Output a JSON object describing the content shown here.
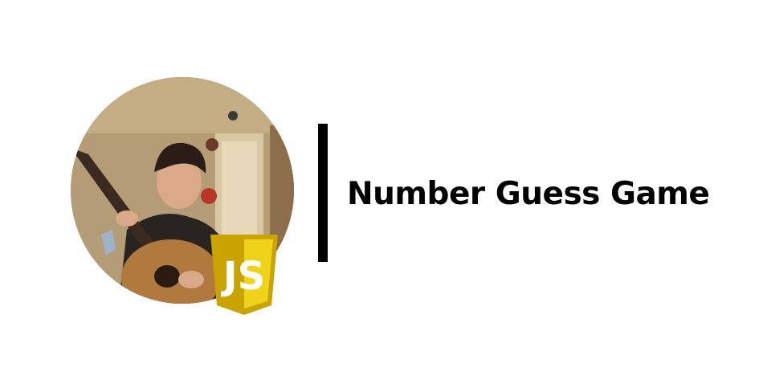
{
  "header": {
    "title": "Number Guess Game"
  },
  "avatar": {
    "icon": "profile-photo-guitar"
  },
  "badge": {
    "icon": "javascript-shield-icon",
    "text": "JS",
    "colors": {
      "shield_dark": "#c9a400",
      "shield_light": "#f0d21b",
      "letters": "#ffffff"
    }
  },
  "colors": {
    "background": "#ffffff",
    "divider": "#000000",
    "title": "#000000"
  }
}
